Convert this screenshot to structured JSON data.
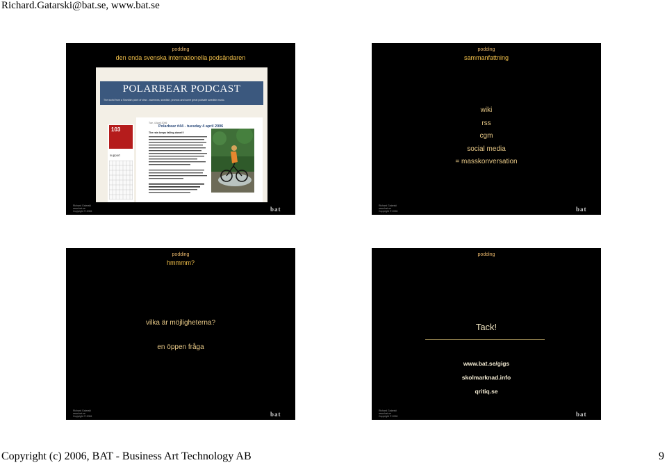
{
  "page": {
    "header": "Richard.Gatarski@bat.se, www.bat.se",
    "footer": "Copyright (c) 2006, BAT - Business Art Technology AB",
    "page_number": "9"
  },
  "slide_footer": {
    "name": "Richard Gatarski",
    "line2": "www.bat.se",
    "line3": "Copyright © 2006",
    "logo_text": "bat"
  },
  "slides": [
    {
      "label": "podding",
      "title": "den enda svenska internationella podsändaren",
      "screenshot": {
        "banner_title": "POLARBEAR PODCAST",
        "banner_sub": "The world from a Swedish point of view - swenews, swedish, promos and some great podsafe swedish music.",
        "logo_text": "103",
        "support": "support",
        "date": "Tue, 4 April 2006",
        "post_title": "Polarbear #44 - tuesday 4 april 2006",
        "post_sub": "The rain keeps falling down!!!"
      }
    },
    {
      "label": "podding",
      "title": "sammanfattning",
      "items": [
        "wiki",
        "rss",
        "cgm",
        "social media",
        "= masskonversation"
      ]
    },
    {
      "label": "podding",
      "title": "hmmmm?",
      "lines": [
        "vilka är möjligheterna?",
        "en öppen fråga"
      ]
    },
    {
      "label": "podding",
      "title": "",
      "thanks": "Tack!",
      "links": [
        "www.bat.se/gigs",
        "skolmarknad.info",
        "qritiq.se"
      ]
    }
  ]
}
